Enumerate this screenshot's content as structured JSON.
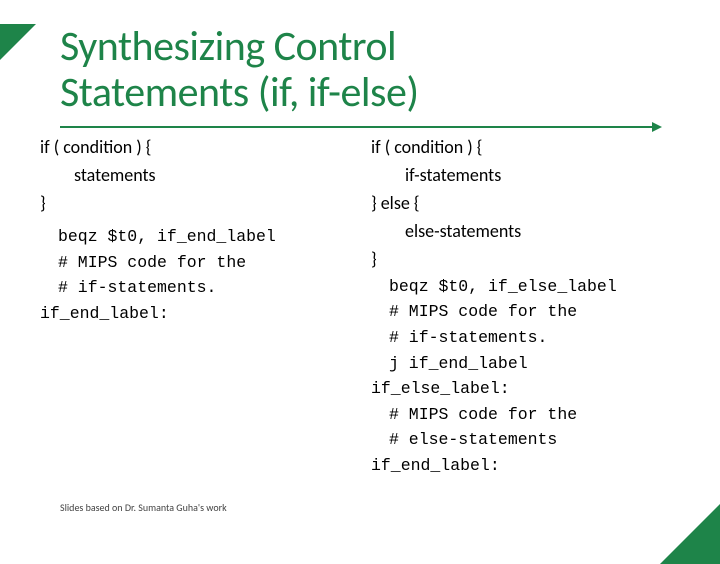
{
  "title_line1": "Synthesizing Control",
  "title_line2": "Statements (if, if-else)",
  "left": {
    "syntax": {
      "l1": "if ( condition ) {",
      "l2": "statements",
      "l3": "}"
    },
    "code": {
      "l1": "beqz  $t0, if_end_label",
      "l2": "# MIPS code for the",
      "l3": "# if-statements.",
      "l4": "if_end_label:"
    }
  },
  "right": {
    "syntax": {
      "l1": "if ( condition ) {",
      "l2": "if-statements",
      "l3": "} else {",
      "l4": "else-statements",
      "l5": "}"
    },
    "code": {
      "l1": "beqz   $t0, if_else_label",
      "l2": "# MIPS code for the",
      "l3": "# if-statements.",
      "l4": "j if_end_label",
      "l5": "if_else_label:",
      "l6": "# MIPS code for the",
      "l7": "# else-statements",
      "l8": "if_end_label:"
    }
  },
  "credit": "Slides based on Dr. Sumanta Guha's work"
}
